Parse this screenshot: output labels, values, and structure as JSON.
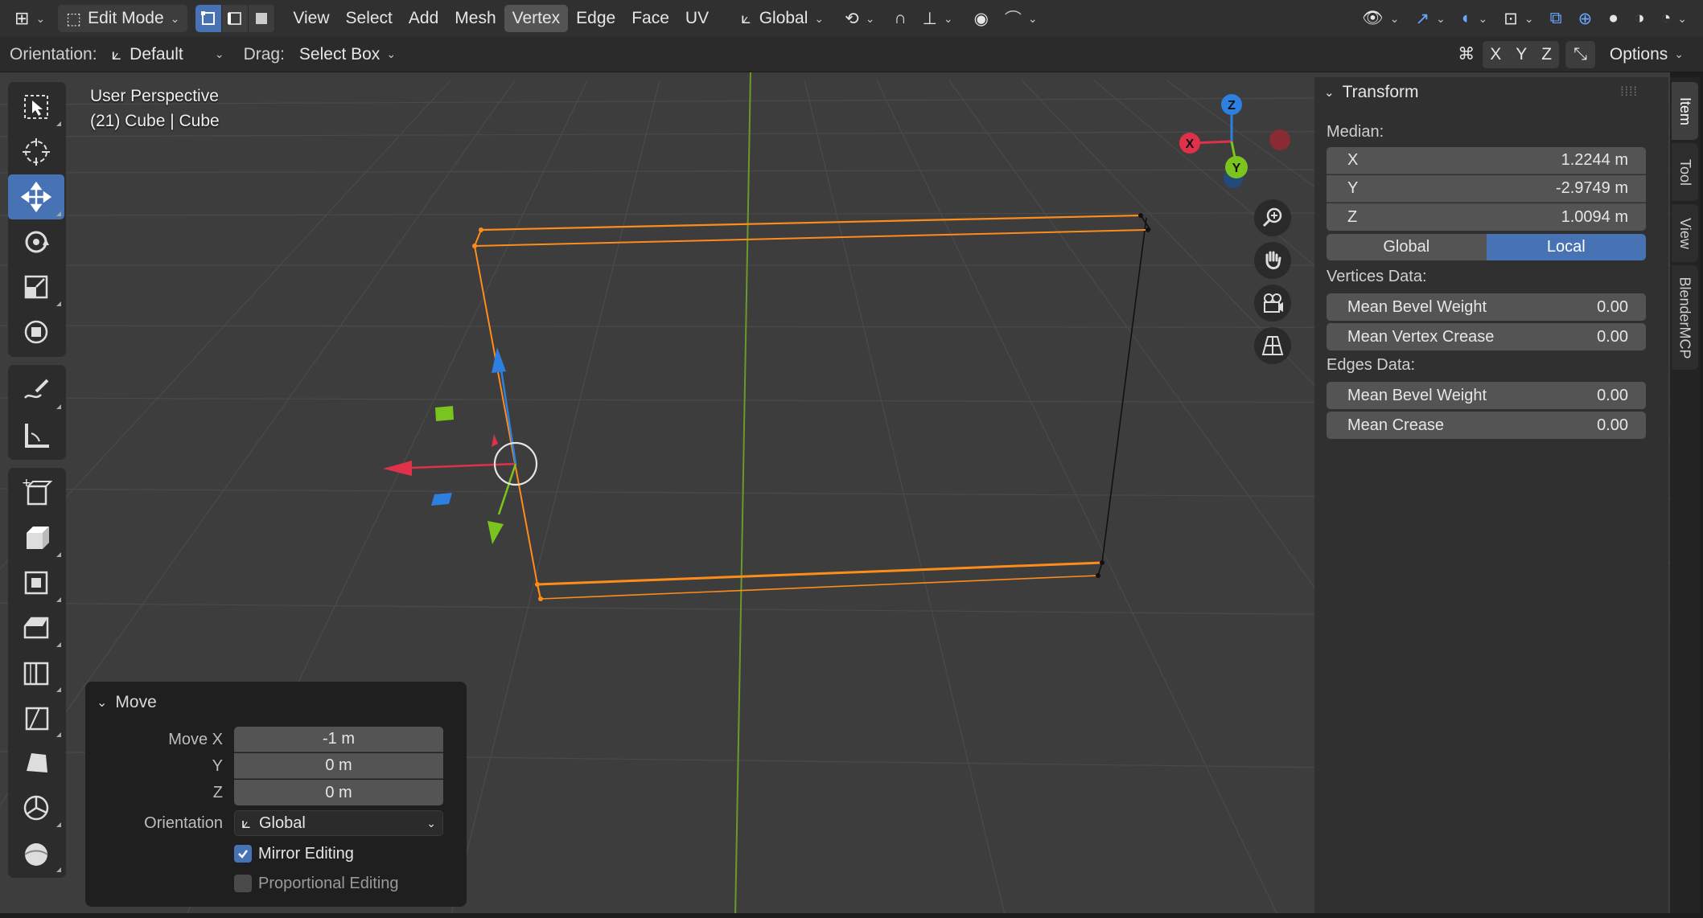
{
  "header": {
    "mode_label": "Edit Mode",
    "menus": [
      "View",
      "Select",
      "Add",
      "Mesh",
      "Vertex",
      "Edge",
      "Face",
      "UV"
    ],
    "active_menu_index": 4,
    "transform_orientation": "Global"
  },
  "header2": {
    "orientation_label": "Orientation:",
    "orientation_value": "Default",
    "drag_label": "Drag:",
    "drag_value": "Select Box",
    "axis_x": "X",
    "axis_y": "Y",
    "axis_z": "Z",
    "options_label": "Options"
  },
  "viewport": {
    "view_name": "User Perspective",
    "object_info": "(21) Cube | Cube"
  },
  "gizmo": {
    "x": "X",
    "y": "Y",
    "z": "Z"
  },
  "operator_panel": {
    "title": "Move",
    "move_x_label": "Move X",
    "move_x": "-1 m",
    "y_label": "Y",
    "move_y": "0 m",
    "z_label": "Z",
    "move_z": "0 m",
    "orientation_label": "Orientation",
    "orientation_value": "Global",
    "mirror_label": "Mirror Editing",
    "mirror_checked": true,
    "proportional_label": "Proportional Editing",
    "proportional_checked": false
  },
  "sidebar": {
    "section_title": "Transform",
    "median_label": "Median:",
    "x_label": "X",
    "x_value": "1.2244 m",
    "y_label": "Y",
    "y_value": "-2.9749 m",
    "z_label": "Z",
    "z_value": "1.0094 m",
    "space_global": "Global",
    "space_local": "Local",
    "active_space": "Local",
    "vertices_data_label": "Vertices Data:",
    "v_bevel_label": "Mean Bevel Weight",
    "v_bevel_value": "0.00",
    "v_crease_label": "Mean Vertex Crease",
    "v_crease_value": "0.00",
    "edges_data_label": "Edges Data:",
    "e_bevel_label": "Mean Bevel Weight",
    "e_bevel_value": "0.00",
    "e_crease_label": "Mean Crease",
    "e_crease_value": "0.00",
    "tabs": [
      "Item",
      "Tool",
      "View",
      "BlenderMCP"
    ]
  },
  "colors": {
    "accent": "#4772b3",
    "selection": "#ff8c1a",
    "axis_x": "#e0314a",
    "axis_y": "#7bc41f",
    "axis_z": "#2d7fe0"
  }
}
